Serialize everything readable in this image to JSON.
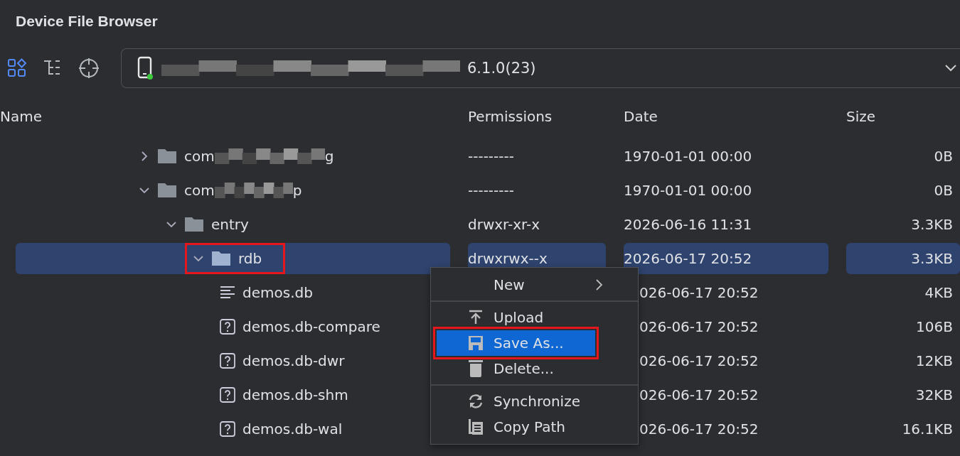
{
  "window": {
    "title": "Device File Browser"
  },
  "toolbar": {
    "device": {
      "label": "6.1.0(23)",
      "online": true
    }
  },
  "table": {
    "columns": [
      "Name",
      "Permissions",
      "Date",
      "Size"
    ],
    "tree": [
      {
        "name": "com",
        "name_tail": "g",
        "kind": "folder",
        "expanded": false,
        "selected": false,
        "permissions": "---------",
        "date": "1970-01-01 00:00",
        "size": "0B"
      },
      {
        "name": "com",
        "name_tail": "p",
        "kind": "folder",
        "expanded": true,
        "selected": false,
        "permissions": "---------",
        "date": "1970-01-01 00:00",
        "size": "0B",
        "children": [
          {
            "name": "entry",
            "kind": "folder",
            "expanded": true,
            "selected": false,
            "permissions": "drwxr-xr-x",
            "date": "2026-06-16 11:31",
            "size": "3.3KB",
            "children": [
              {
                "name": "rdb",
                "kind": "folder",
                "expanded": true,
                "selected": true,
                "annotated": true,
                "permissions": "drwxrwx--x",
                "date": "2026-06-17 20:52",
                "size": "3.3KB",
                "children": [
                  {
                    "name": "demos.db",
                    "kind": "text",
                    "date": "026-06-17 20:52",
                    "size": "4KB"
                  },
                  {
                    "name": "demos.db-compare",
                    "kind": "unknown",
                    "date": "026-06-17 20:52",
                    "size": "106B"
                  },
                  {
                    "name": "demos.db-dwr",
                    "kind": "unknown",
                    "date": "026-06-17 20:52",
                    "size": "12KB"
                  },
                  {
                    "name": "demos.db-shm",
                    "kind": "unknown",
                    "date": "026-06-17 20:52",
                    "size": "32KB"
                  },
                  {
                    "name": "demos.db-wal",
                    "kind": "unknown",
                    "date": "026-06-17 20:52",
                    "size": "16.1KB"
                  }
                ]
              }
            ]
          }
        ]
      }
    ]
  },
  "context_menu": {
    "groups": [
      [
        {
          "label": "New",
          "submenu": true,
          "selected": false,
          "annotated": false
        }
      ],
      [
        {
          "label": "Upload",
          "submenu": false,
          "selected": false,
          "annotated": false
        },
        {
          "label": "Save As...",
          "submenu": false,
          "selected": true,
          "annotated": true
        },
        {
          "label": "Delete...",
          "submenu": false,
          "selected": false,
          "annotated": false
        }
      ],
      [
        {
          "label": "Synchronize",
          "submenu": false,
          "selected": false,
          "annotated": false
        },
        {
          "label": "Copy Path",
          "submenu": false,
          "selected": false,
          "annotated": false
        }
      ]
    ]
  }
}
